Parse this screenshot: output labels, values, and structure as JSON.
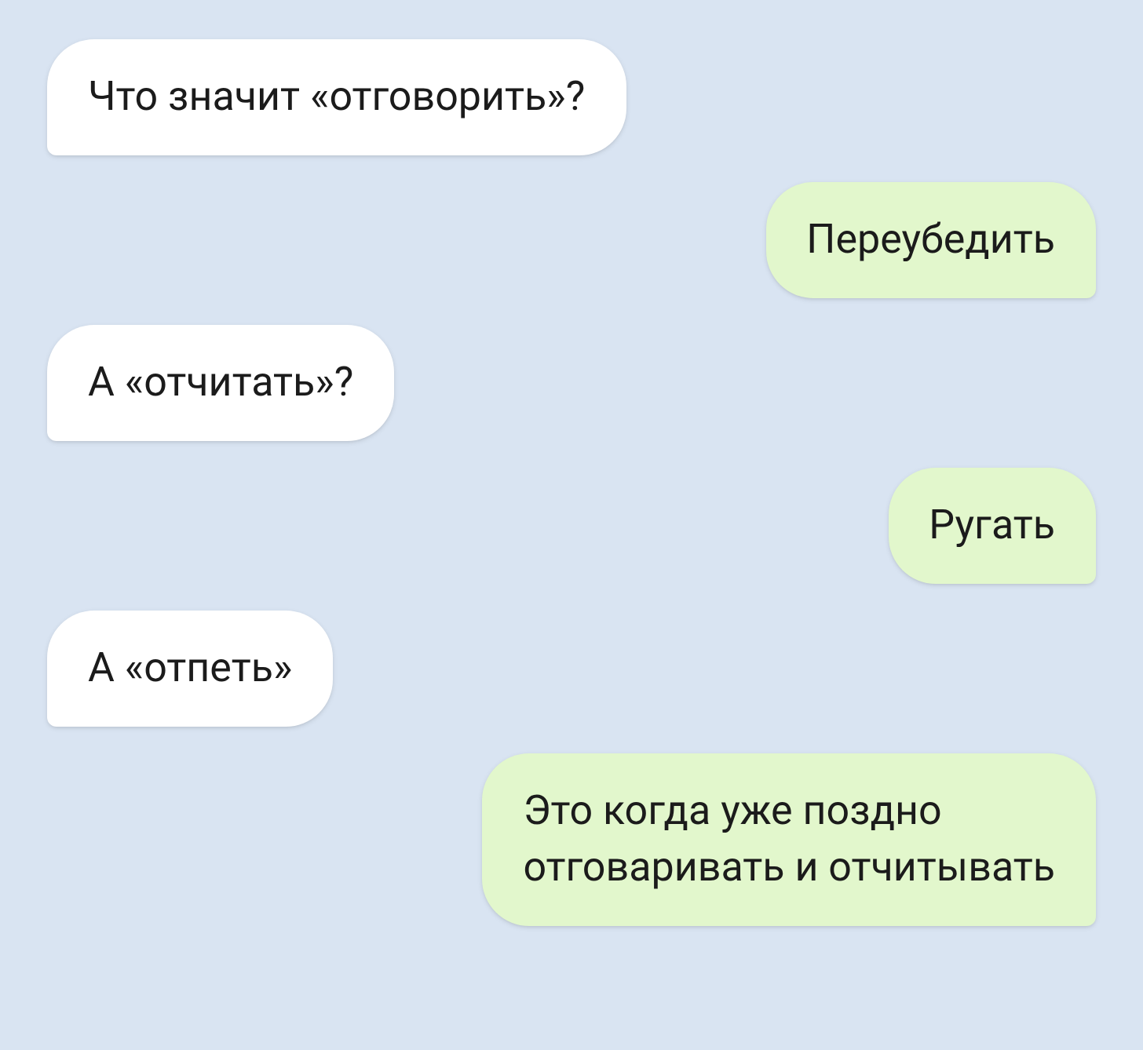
{
  "messages": [
    {
      "kind": "incoming",
      "text": "Что значит «отговорить»?"
    },
    {
      "kind": "outgoing",
      "text": "Переубедить"
    },
    {
      "kind": "incoming",
      "text": "А «отчитать»?"
    },
    {
      "kind": "outgoing",
      "text": "Ругать"
    },
    {
      "kind": "incoming",
      "text": "А «отпеть»"
    },
    {
      "kind": "outgoing",
      "text": "Это когда уже поздно\nотговаривать и отчитывать"
    }
  ]
}
